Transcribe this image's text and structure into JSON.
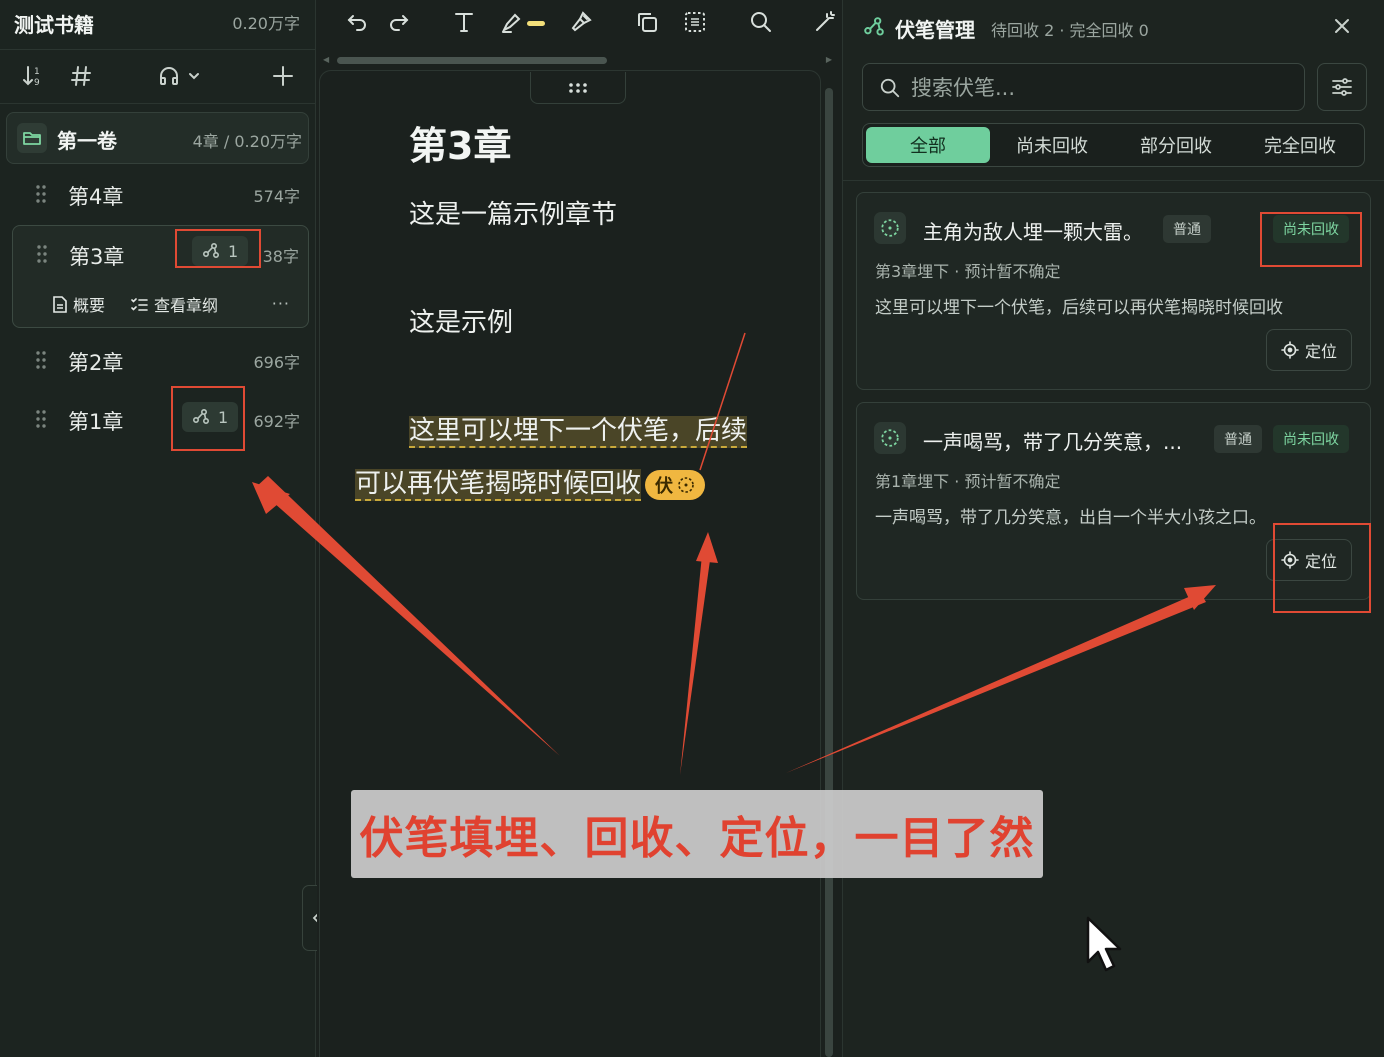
{
  "sidebar": {
    "book_title": "测试书籍",
    "book_words": "0.20万字",
    "volume": {
      "title": "第一卷",
      "meta": "4章 / 0.20万字"
    },
    "chapters": [
      {
        "title": "第4章",
        "words": "574字",
        "foreshadow_count": ""
      },
      {
        "title": "第3章",
        "words": "38字",
        "foreshadow_count": "1"
      },
      {
        "title": "第2章",
        "words": "696字",
        "foreshadow_count": ""
      },
      {
        "title": "第1章",
        "words": "692字",
        "foreshadow_count": "1"
      }
    ],
    "active_actions": {
      "summary": "概要",
      "outline": "查看章纲",
      "more": "···"
    }
  },
  "editor": {
    "heading": "第3章",
    "paragraphs": [
      "这是一篇示例章节",
      "这是示例"
    ],
    "highlight_line1": "这里可以埋下一个伏笔，后续",
    "highlight_line2": "可以再伏笔揭晓时候回收",
    "foreshadow_chip": "伏"
  },
  "panel": {
    "title": "伏笔管理",
    "subtitle": "待回收 2 · 完全回收 0",
    "search_placeholder": "搜索伏笔...",
    "tabs": [
      "全部",
      "尚未回收",
      "部分回收",
      "完全回收"
    ],
    "active_tab": "全部",
    "cards": [
      {
        "title": "主角为敌人埋一颗大雷。",
        "type": "普通",
        "status": "尚未回收",
        "meta": "第3章埋下 · 预计暂不确定",
        "desc": "这里可以埋下一个伏笔，后续可以再伏笔揭晓时候回收",
        "locate": "定位"
      },
      {
        "title": "一声喝骂，带了几分笑意，...",
        "type": "普通",
        "status": "尚未回收",
        "meta": "第1章埋下 · 预计暂不确定",
        "desc": "一声喝骂，带了几分笑意，出自一个半大小孩之口。",
        "locate": "定位"
      }
    ]
  },
  "overlay": {
    "caption": "伏笔填埋、回收、定位，一目了然"
  },
  "colors": {
    "accent": "#6fce9d",
    "annotation": "#e04a34",
    "chip": "#f0b740",
    "background": "#1b211e"
  },
  "icons": [
    "sort-icon",
    "hash-icon",
    "headphones-icon",
    "plus-icon",
    "folder-icon",
    "drag-handle-icon",
    "foreshadow-icon",
    "document-icon",
    "outline-list-icon",
    "undo-icon",
    "redo-icon",
    "text-icon",
    "highlighter-icon",
    "brush-icon",
    "copy-icon",
    "select-icon",
    "search-icon",
    "magic-wand-icon",
    "close-icon",
    "filter-icon",
    "dashed-circle-icon",
    "crosshair-icon",
    "chevron-left-icon",
    "cursor-icon"
  ]
}
